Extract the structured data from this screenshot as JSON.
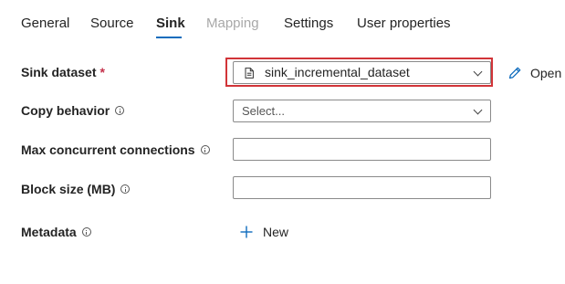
{
  "tabs": [
    {
      "label": "General",
      "state": "normal"
    },
    {
      "label": "Source",
      "state": "normal"
    },
    {
      "label": "Sink",
      "state": "active"
    },
    {
      "label": "Mapping",
      "state": "disabled"
    },
    {
      "label": "Settings",
      "state": "normal"
    },
    {
      "label": "User properties",
      "state": "normal"
    }
  ],
  "form": {
    "sink_dataset": {
      "label": "Sink dataset",
      "required_marker": "*",
      "value": "sink_incremental_dataset",
      "icon": "dataset-document-icon",
      "open_label": "Open",
      "open_icon": "pencil-icon"
    },
    "copy_behavior": {
      "label": "Copy behavior",
      "info_icon": "info-icon",
      "placeholder": "Select..."
    },
    "max_concurrent_connections": {
      "label": "Max concurrent connections",
      "info_icon": "info-icon",
      "value": ""
    },
    "block_size": {
      "label": "Block size (MB)",
      "info_icon": "info-icon",
      "value": ""
    },
    "metadata": {
      "label": "Metadata",
      "info_icon": "info-icon",
      "new_label": "New",
      "new_icon": "plus-icon"
    }
  },
  "colors": {
    "accent": "#0f6cbd",
    "highlight": "#d13438",
    "required": "#c4314b",
    "disabled": "#a8a8a8"
  }
}
